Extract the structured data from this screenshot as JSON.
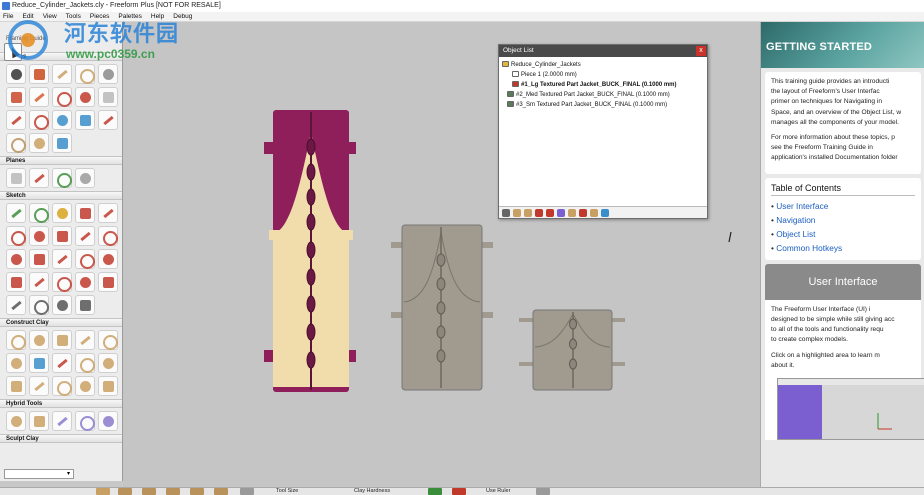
{
  "window": {
    "title": "Reduce_Cylinder_Jackets.cly - Freeform Plus [NOT FOR RESALE]"
  },
  "menu": [
    "File",
    "Edit",
    "View",
    "Tools",
    "Pieces",
    "Palettes",
    "Help",
    "Debug"
  ],
  "toolbox": {
    "caption": "Framing Guide",
    "sections": [
      {
        "name": "Curves",
        "tools": [
          {
            "icon": "select-arrow-icon",
            "color": "#333333"
          },
          {
            "icon": "curve-pen-icon",
            "color": "#c84a1e"
          },
          {
            "icon": "surface-shape-icon",
            "color": "#c9a063"
          },
          {
            "icon": "sphere-clay-icon",
            "color": "#c9a063"
          },
          {
            "icon": "curve-sketch-icon",
            "color": "#8a8a8a"
          },
          {
            "icon": "knot-icon",
            "color": "#c8482a"
          },
          {
            "icon": "curve-loop-icon",
            "color": "#d65a2c"
          },
          {
            "icon": "hook-icon",
            "color": "#c0392b"
          },
          {
            "icon": "curve-edit-icon",
            "color": "#c0392b"
          },
          {
            "icon": "block-icon",
            "color": "#b8b8b8"
          },
          {
            "icon": "twist-icon",
            "color": "#c0392b"
          },
          {
            "icon": "split-icon",
            "color": "#c0392b"
          },
          {
            "icon": "pipe-icon",
            "color": "#3a8ec9"
          },
          {
            "icon": "cube-cut-icon",
            "color": "#3a8ec9"
          },
          {
            "icon": "curve-offset-icon",
            "color": "#c0392b"
          },
          {
            "icon": "lattice-icon",
            "color": "#b8915b"
          },
          {
            "icon": "fan-icon",
            "color": "#c9a063"
          },
          {
            "icon": "sweep-icon",
            "color": "#3a8ec9"
          }
        ]
      },
      {
        "name": "Planes",
        "tools": [
          {
            "icon": "plane-icon",
            "color": "#b8b8b8"
          },
          {
            "icon": "plane-cut-icon",
            "color": "#c0392b"
          },
          {
            "icon": "plane-check-icon",
            "color": "#3a8e3a"
          },
          {
            "icon": "plane-stack-icon",
            "color": "#9a9a9a"
          }
        ]
      },
      {
        "name": "Sketch",
        "tools": [
          {
            "icon": "sketch-select-icon",
            "color": "#3a8e3a"
          },
          {
            "icon": "sketch-point-icon",
            "color": "#3a8e3a"
          },
          {
            "icon": "sketch-pencil-icon",
            "color": "#d6a31e"
          },
          {
            "icon": "sketch-curve-icon",
            "color": "#c0392b"
          },
          {
            "icon": "sketch-spline-icon",
            "color": "#c0392b"
          },
          {
            "icon": "sketch-line-icon",
            "color": "#c0392b"
          },
          {
            "icon": "sketch-diag-icon",
            "color": "#c0392b"
          },
          {
            "icon": "sketch-lines-icon",
            "color": "#c0392b"
          },
          {
            "icon": "sketch-arc-icon",
            "color": "#c0392b"
          },
          {
            "icon": "sketch-circle-icon",
            "color": "#c0392b"
          },
          {
            "icon": "sketch-wave-icon",
            "color": "#c0392b"
          },
          {
            "icon": "sketch-star-icon",
            "color": "#c0392b"
          },
          {
            "icon": "sketch-hexagon-icon",
            "color": "#c0392b"
          },
          {
            "icon": "sketch-rect-icon",
            "color": "#c0392b"
          },
          {
            "icon": "sketch-text-icon",
            "color": "#c0392b"
          },
          {
            "icon": "sketch-swirl-icon",
            "color": "#c0392b"
          },
          {
            "icon": "sketch-loop-icon",
            "color": "#c0392b"
          },
          {
            "icon": "sketch-mirror-icon",
            "color": "#c0392b"
          },
          {
            "icon": "sketch-node-icon",
            "color": "#c0392b"
          },
          {
            "icon": "sketch-dots-icon",
            "color": "#c0392b"
          },
          {
            "icon": "sketch-grid-icon",
            "color": "#555555"
          },
          {
            "icon": "sketch-grid2-icon",
            "color": "#555555"
          },
          {
            "icon": "sketch-mesh-icon",
            "color": "#555555"
          },
          {
            "icon": "sketch-import-icon",
            "color": "#555555"
          }
        ]
      },
      {
        "name": "Construct Clay",
        "tools": [
          {
            "icon": "clay-wave-icon",
            "color": "#c9a063"
          },
          {
            "icon": "clay-blob-icon",
            "color": "#c9a063"
          },
          {
            "icon": "clay-bowl-icon",
            "color": "#c9a063"
          },
          {
            "icon": "clay-extrude-icon",
            "color": "#c9a063"
          },
          {
            "icon": "clay-pipe-icon",
            "color": "#c9a063"
          },
          {
            "icon": "clay-ribbon-icon",
            "color": "#c9a063"
          },
          {
            "icon": "clay-surface-icon",
            "color": "#3a8ec9"
          },
          {
            "icon": "clay-face-icon",
            "color": "#c0392b"
          },
          {
            "icon": "clay-hook-icon",
            "color": "#c9a063"
          },
          {
            "icon": "clay-twist-icon",
            "color": "#c9a063"
          },
          {
            "icon": "clay-chess-icon",
            "color": "#c9a063"
          },
          {
            "icon": "clay-cup-icon",
            "color": "#c9a063"
          },
          {
            "icon": "clay-ring-icon",
            "color": "#c9a063"
          },
          {
            "icon": "clay-torus-icon",
            "color": "#c9a063"
          },
          {
            "icon": "clay-spool-icon",
            "color": "#c9a063"
          }
        ]
      },
      {
        "name": "Hybrid Tools",
        "tools": [
          {
            "icon": "hybrid-bean-icon",
            "color": "#c9a063"
          },
          {
            "icon": "hybrid-capsule-icon",
            "color": "#c9a063"
          },
          {
            "icon": "hybrid-cube-icon",
            "color": "#8a7acb"
          },
          {
            "icon": "hybrid-shell-icon",
            "color": "#8a7acb"
          },
          {
            "icon": "hybrid-block-icon",
            "color": "#8a7acb"
          }
        ]
      },
      {
        "name": "Sculpt Clay",
        "tools": []
      }
    ]
  },
  "object_list": {
    "title": "Object List",
    "close": "x",
    "rows": [
      {
        "label": "Reduce_Cylinder_Jackets",
        "bold": false,
        "indent": 0,
        "color": "#e3b53c"
      },
      {
        "label": "Piece 1 (2.0000 mm)",
        "bold": false,
        "indent": 2,
        "color": "#ffffff"
      },
      {
        "label": "#1_Lg Textured Part Jacket_BUCK_FINAL (0.1000 mm)",
        "bold": true,
        "indent": 2,
        "color": "#c0392b"
      },
      {
        "label": "#2_Med Textured Part Jacket_BUCK_FINAL (0.1000 mm)",
        "bold": false,
        "indent": 1,
        "color": "#5a7a5a"
      },
      {
        "label": "#3_Sm Textured Part Jacket_BUCK_FINAL (0.1000 mm)",
        "bold": false,
        "indent": 1,
        "color": "#5a7a5a"
      }
    ]
  },
  "guide": {
    "hero_title": "GETTING STARTED",
    "intro": [
      "This training guide provides an introducti",
      "the layout of Freeform's User Interfac",
      "primer on techniques for Navigating in",
      "Space, and an overview of the Object List, w",
      "manages all the components of your model."
    ],
    "more": [
      "For more information about these topics, p",
      "see the Freeform Training Guide in",
      "application's installed Documentation folder"
    ],
    "toc_title": "Table of Contents",
    "toc": [
      "User Interface",
      "Navigation",
      "Object List",
      "Common Hotkeys"
    ],
    "ui_section_title": "User Interface",
    "ui_text": [
      "The Freeform User Interface (UI) i",
      "designed to be simple while still giving acc",
      "to all of the tools and functionality requ",
      "to create complex models."
    ],
    "ui_hint": [
      "Click on a highlighted area to learn m",
      "about it."
    ]
  },
  "bottombar": {
    "tool_size": "Tool Size",
    "clay_hardness": "Clay Hardness",
    "use_ruler": "Use Ruler"
  },
  "watermark": {
    "name": "河东软件园",
    "url": "www.pc0359.cn"
  },
  "colors": {
    "jacket_large_magenta": "#8e1f5a",
    "jacket_large_cream": "#f1dcac",
    "jacket_grey": "#a09a8f",
    "link_blue": "#1b5fbf"
  }
}
